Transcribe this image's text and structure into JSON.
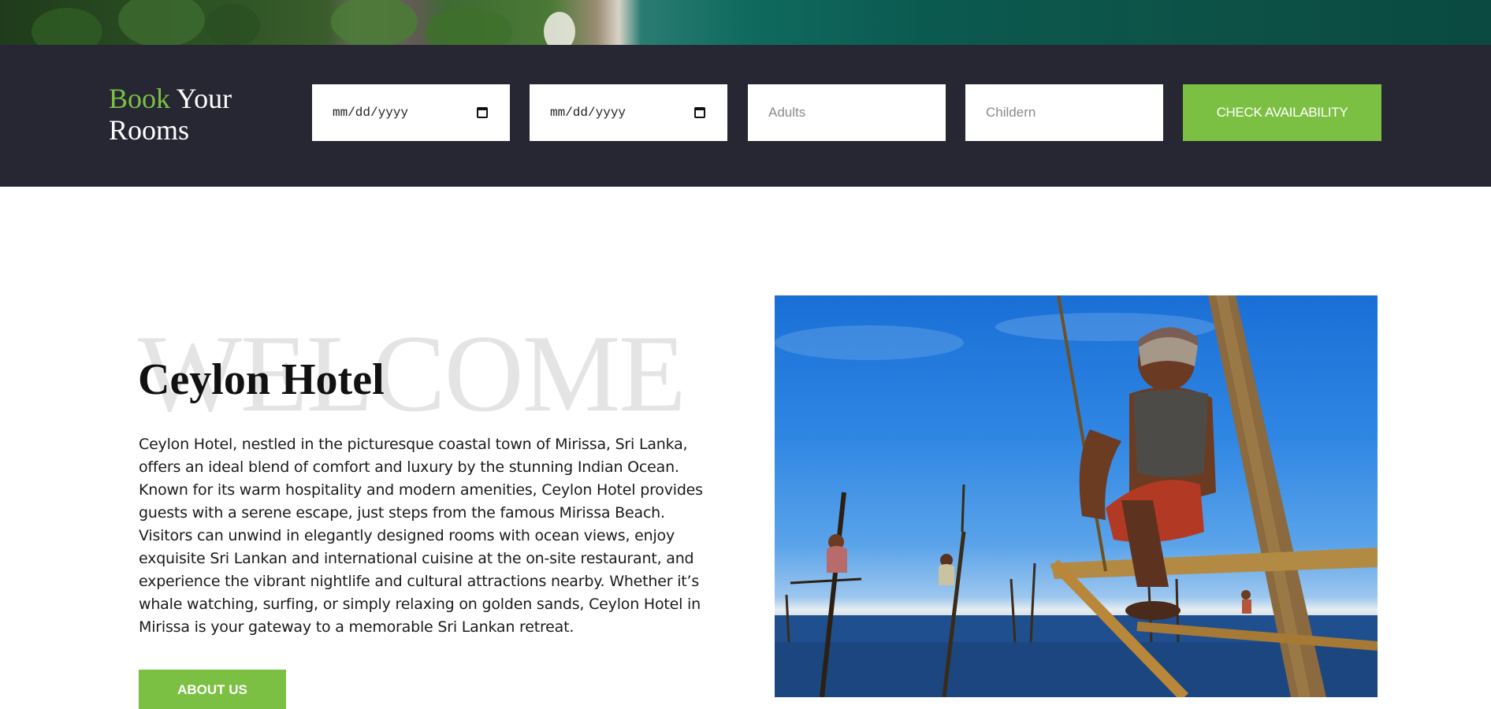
{
  "booking": {
    "title_accent": "Book",
    "title_rest_1": " Your",
    "title_rest_2": "Rooms",
    "checkin_value": "mm/dd/yyyy",
    "checkout_value": "mm/dd/yyyy",
    "adults_placeholder": "Adults",
    "children_placeholder": "Childern",
    "check_button": "CHECK AVAILABILITY"
  },
  "welcome": {
    "watermark": "WELCOME",
    "title": "Ceylon Hotel",
    "description": "Ceylon Hotel, nestled in the picturesque coastal town of Mirissa, Sri Lanka, offers an ideal blend of comfort and luxury by the stunning Indian Ocean. Known for its warm hospitality and modern amenities, Ceylon Hotel provides guests with a serene escape, just steps from the famous Mirissa Beach. Visitors can unwind in elegantly designed rooms with ocean views, enjoy exquisite Sri Lankan and international cuisine at the on-site restaurant, and experience the vibrant nightlife and cultural attractions nearby. Whether it’s whale watching, surfing, or simply relaxing on golden sands, Ceylon Hotel in Mirissa is your gateway to a memorable Sri Lankan retreat.",
    "about_button": "ABOUT US"
  },
  "colors": {
    "accent": "#7cc043",
    "booking_bar_bg": "#262733",
    "watermark": "#e4e4e4"
  },
  "icons": {
    "date_picker": "calendar-icon"
  }
}
